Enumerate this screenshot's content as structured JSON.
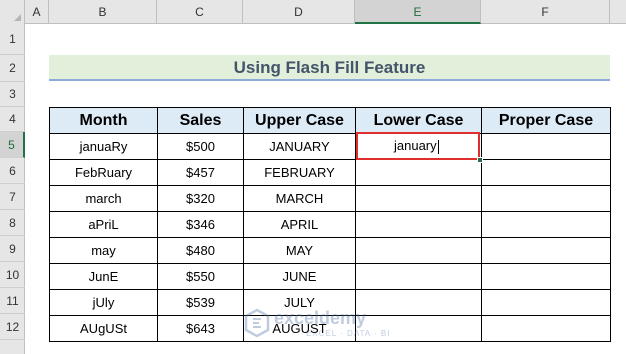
{
  "columns": [
    "A",
    "B",
    "C",
    "D",
    "E",
    "F"
  ],
  "rows": [
    "1",
    "2",
    "3",
    "4",
    "5",
    "6",
    "7",
    "8",
    "9",
    "10",
    "11",
    "12"
  ],
  "selected": {
    "column": "E",
    "row": "5"
  },
  "title": "Using Flash Fill Feature",
  "table": {
    "headers": [
      "Month",
      "Sales",
      "Upper Case",
      "Lower Case",
      "Proper Case"
    ],
    "rows": [
      {
        "month": "januaRy",
        "sales": "$500",
        "upper": "JANUARY"
      },
      {
        "month": "FebRuary",
        "sales": "$457",
        "upper": "FEBRUARY"
      },
      {
        "month": "march",
        "sales": "$320",
        "upper": "MARCH"
      },
      {
        "month": "aPriL",
        "sales": "$346",
        "upper": "APRIL"
      },
      {
        "month": "may",
        "sales": "$480",
        "upper": "MAY"
      },
      {
        "month": "JunE",
        "sales": "$550",
        "upper": "JUNE"
      },
      {
        "month": "jUly",
        "sales": "$539",
        "upper": "JULY"
      },
      {
        "month": "AUgUSt",
        "sales": "$643",
        "upper": "AUGUST"
      }
    ]
  },
  "active_cell_value": "january",
  "watermark": {
    "name": "exceldemy",
    "sub": "EXCEL · DATA · BI"
  },
  "colors": {
    "accent": "#217346",
    "active_border": "#e02d2d",
    "title_bg": "#e2efda",
    "header_bg": "#ddebf7"
  }
}
